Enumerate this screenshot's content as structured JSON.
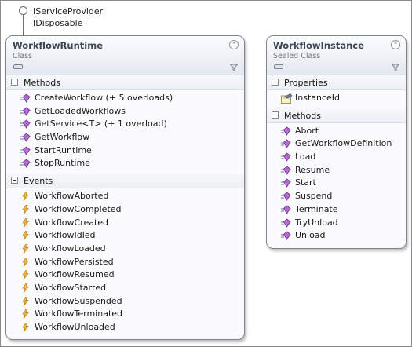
{
  "interfaces": [
    "IServiceProvider",
    "IDisposable"
  ],
  "shapes": {
    "runtime": {
      "title": "WorkflowRuntime",
      "kind": "Class",
      "sections": {
        "methods": {
          "label": "Methods",
          "items": [
            "CreateWorkflow (+ 5 overloads)",
            "GetLoadedWorkflows",
            "GetService<T> (+ 1 overload)",
            "GetWorkflow",
            "StartRuntime",
            "StopRuntime"
          ]
        },
        "events": {
          "label": "Events",
          "items": [
            "WorkflowAborted",
            "WorkflowCompleted",
            "WorkflowCreated",
            "WorkflowIdled",
            "WorkflowLoaded",
            "WorkflowPersisted",
            "WorkflowResumed",
            "WorkflowStarted",
            "WorkflowSuspended",
            "WorkflowTerminated",
            "WorkflowUnloaded"
          ]
        }
      }
    },
    "instance": {
      "title": "WorkflowInstance",
      "kind": "Sealed Class",
      "sections": {
        "properties": {
          "label": "Properties",
          "items": [
            "InstanceId"
          ]
        },
        "methods": {
          "label": "Methods",
          "items": [
            "Abort",
            "GetWorkflowDefinition",
            "Load",
            "Resume",
            "Start",
            "Suspend",
            "Terminate",
            "TryUnload",
            "Unload"
          ]
        }
      }
    }
  },
  "icons": {
    "method": "method-icon",
    "event": "event-icon",
    "property": "property-icon",
    "collapse": "double-chevron-up-icon",
    "filter": "filter-icon"
  },
  "colors": {
    "method": "#9b59b6",
    "event": "#e0a43a",
    "header_title": "#3c4654"
  }
}
